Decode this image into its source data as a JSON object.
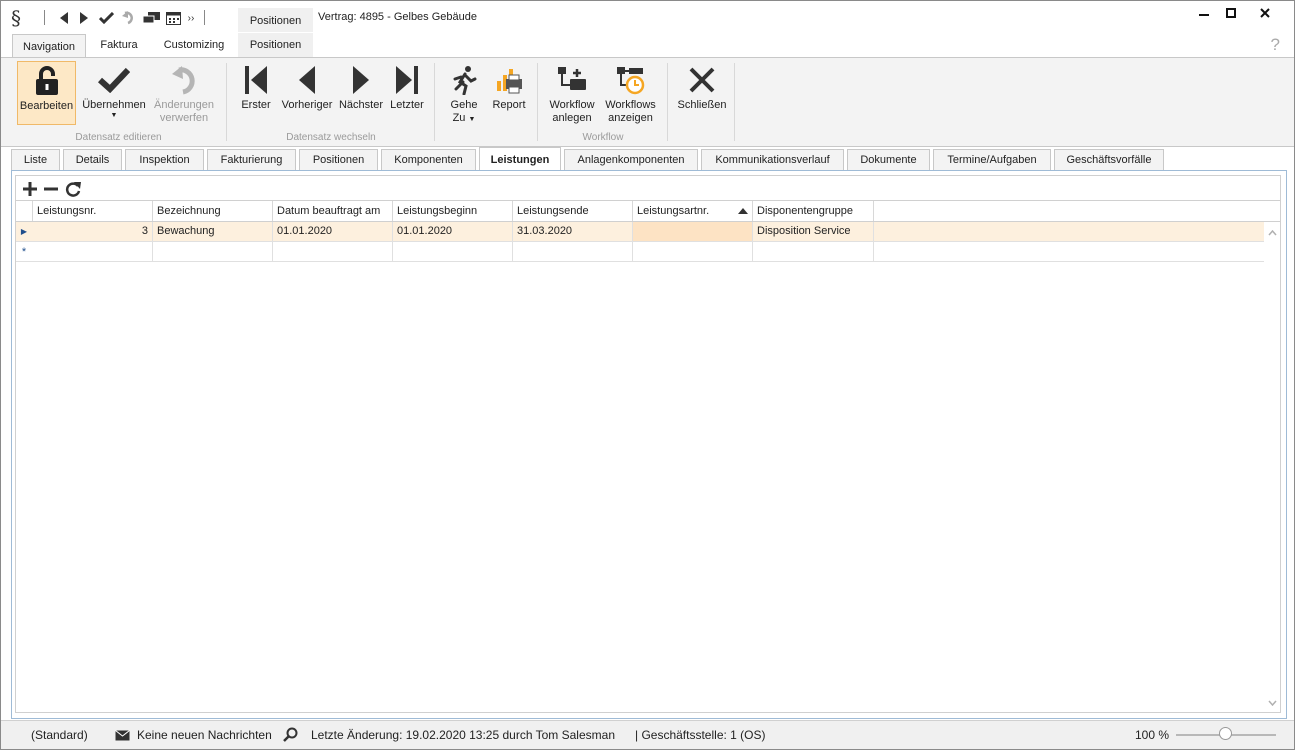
{
  "app": {
    "logo": "§",
    "context_tab_top": "Positionen",
    "window_title": "Vertrag: 4895 - Gelbes Gebäude",
    "help": "?"
  },
  "ribbon_tabs": [
    "Navigation",
    "Faktura",
    "Customizing",
    "Positionen"
  ],
  "ribbon": {
    "bearbeiten": "Bearbeiten",
    "uebernehmen": "Übernehmen",
    "aenderungen_1": "Änderungen",
    "aenderungen_2": "verwerfen",
    "group_datensatz_editieren": "Datensatz editieren",
    "erster": "Erster",
    "vorheriger": "Vorheriger",
    "naechster": "Nächster",
    "letzter": "Letzter",
    "group_datensatz_wechseln": "Datensatz wechseln",
    "gehe_1": "Gehe",
    "gehe_2": "Zu",
    "report": "Report",
    "wf_anlegen_1": "Workflow",
    "wf_anlegen_2": "anlegen",
    "wf_anzeigen_1": "Workflows",
    "wf_anzeigen_2": "anzeigen",
    "group_workflow": "Workflow",
    "schliessen": "Schließen"
  },
  "record_tabs": [
    "Liste",
    "Details",
    "Inspektion",
    "Fakturierung",
    "Positionen",
    "Komponenten",
    "Leistungen",
    "Anlagenkomponenten",
    "Kommunikationsverlauf",
    "Dokumente",
    "Termine/Aufgaben",
    "Geschäftsvorfälle"
  ],
  "active_record_tab": "Leistungen",
  "grid": {
    "columns": [
      "Leistungsnr.",
      "Bezeichnung",
      "Datum beauftragt am",
      "Leistungsbeginn",
      "Leistungsende",
      "Leistungsartnr.",
      "Disponentengruppe"
    ],
    "sorted_column": "Leistungsartnr.",
    "sort_direction": "ascending",
    "rows": [
      {
        "leistungsnr": "3",
        "bezeichnung": "Bewachung",
        "datum_beauftragt": "01.01.2020",
        "leistungsbeginn": "01.01.2020",
        "leistungsende": "31.03.2020",
        "leistungsartnr": "",
        "disponentengruppe": "Disposition Service"
      }
    ],
    "new_row_marker": "*"
  },
  "status": {
    "layout": "(Standard)",
    "messages": "Keine neuen Nachrichten",
    "last_change": "Letzte Änderung: 19.02.2020 13:25 durch Tom Salesman",
    "branch": "| Geschäftsstelle:  1 (OS)",
    "zoom": "100 %"
  }
}
